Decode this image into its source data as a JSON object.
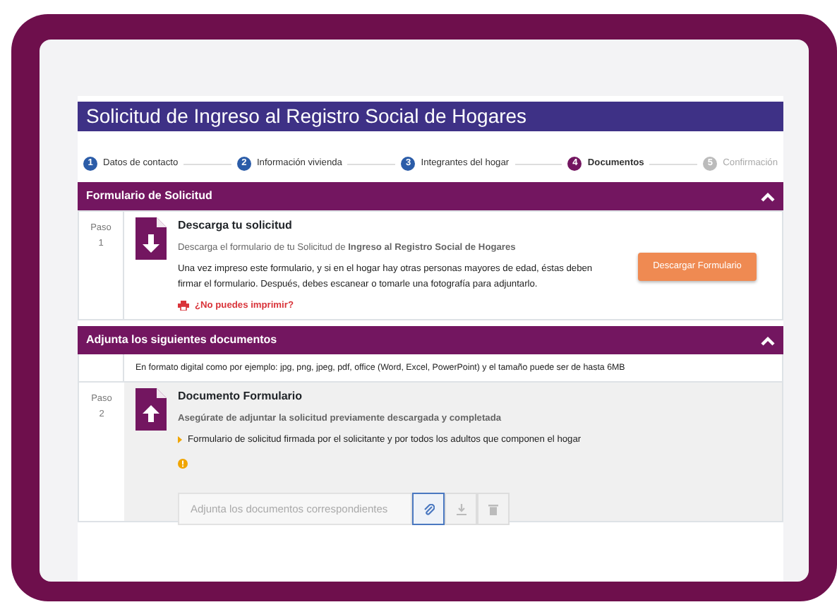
{
  "page_title": "Solicitud de Ingreso al Registro Social de Hogares",
  "steps": [
    {
      "number": "1",
      "label": "Datos de contacto",
      "selected": false,
      "disabled": false
    },
    {
      "number": "2",
      "label": "Información vivienda",
      "selected": false,
      "disabled": false
    },
    {
      "number": "3",
      "label": "Integrantes del hogar",
      "selected": false,
      "disabled": false
    },
    {
      "number": "4",
      "label": "Documentos",
      "selected": true,
      "disabled": false
    },
    {
      "number": "5",
      "label": "Confirmación",
      "selected": false,
      "disabled": true
    }
  ],
  "download_section": {
    "title": "Formulario de Solicitud",
    "expanded": true,
    "step_label": "Paso",
    "step_number": "1",
    "heading": "Descarga tu solicitud",
    "intro": "Descarga el formulario de tu Solicitud de **Ingreso al Registro Social de Hogares**",
    "body": "Una vez impreso este formulario, y si en el hogar hay otras personas mayores de edad, éstas deben firmar el formulario. Después, debes escanear o tomarle una fotografía para adjuntarlo.",
    "print_link": "¿No puedes imprimir?",
    "button": "Descargar Formulario"
  },
  "upload_section": {
    "title": "Adjunta los siguientes documentos",
    "expanded": true,
    "note": "En formato digital como por ejemplo: jpg, png, jpeg, pdf, office (Word, Excel, PowerPoint) y el tamaño puede ser de hasta 6MB",
    "step_label": "Paso",
    "step_number": "2",
    "heading": "Documento Formulario",
    "subheading": "Asegúrate de adjuntar la solicitud previamente descargada y completada",
    "requirement": "Formulario de solicitud firmada por el solicitante y por todos los adultos que componen el hogar",
    "file_placeholder": "Adjunta los documentos correspondientes"
  }
}
